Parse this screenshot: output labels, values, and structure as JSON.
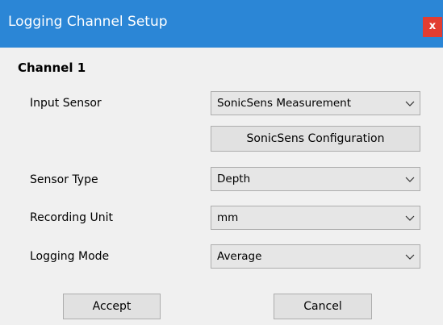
{
  "window": {
    "title": "Logging Channel Setup",
    "close_label": "x",
    "accent_color": "#2b86d6",
    "close_color": "#e23d32"
  },
  "group": {
    "heading": "Channel 1"
  },
  "fields": {
    "input_sensor": {
      "label": "Input Sensor",
      "value": "SonicSens Measurement",
      "icon": "chevron-down-icon"
    },
    "config_button_label": "SonicSens Configuration",
    "sensor_type": {
      "label": "Sensor Type",
      "value": "Depth",
      "icon": "chevron-down-icon"
    },
    "recording_unit": {
      "label": "Recording Unit",
      "value": "mm",
      "icon": "chevron-down-icon"
    },
    "logging_mode": {
      "label": "Logging Mode",
      "value": "Average",
      "icon": "chevron-down-icon"
    }
  },
  "actions": {
    "accept_label": "Accept",
    "cancel_label": "Cancel"
  }
}
